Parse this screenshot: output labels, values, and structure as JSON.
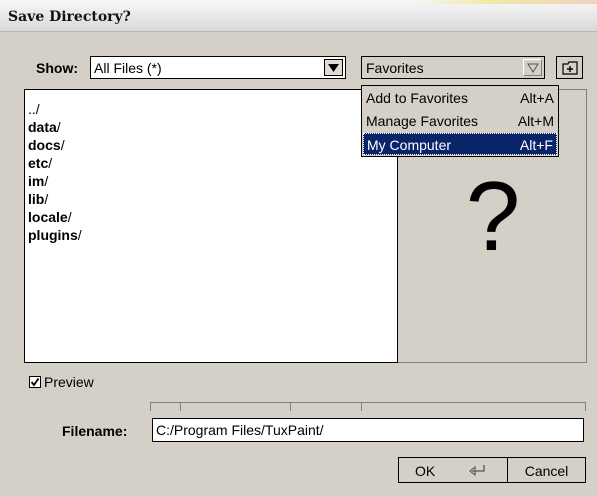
{
  "window": {
    "title": "Save Directory?"
  },
  "filter": {
    "label": "Show:",
    "value": "All Files (*)"
  },
  "favorites": {
    "value": "Favorites",
    "menu": [
      {
        "label": "Add to Favorites",
        "shortcut": "Alt+A",
        "selected": false
      },
      {
        "label": "Manage Favorites",
        "shortcut": "Alt+M",
        "selected": false
      },
      {
        "label": "My Computer",
        "shortcut": "Alt+F",
        "selected": true
      }
    ]
  },
  "files": [
    {
      "name": "..",
      "suffix": "/"
    },
    {
      "name": "data",
      "suffix": "/"
    },
    {
      "name": "docs",
      "suffix": "/"
    },
    {
      "name": "etc",
      "suffix": "/"
    },
    {
      "name": "im",
      "suffix": "/"
    },
    {
      "name": "lib",
      "suffix": "/"
    },
    {
      "name": "locale",
      "suffix": "/"
    },
    {
      "name": "plugins",
      "suffix": "/"
    }
  ],
  "preview": {
    "placeholder": "?",
    "checkbox_label": "Preview",
    "checked": true
  },
  "filename": {
    "label": "Filename:",
    "value": "C:/Program Files/TuxPaint/"
  },
  "buttons": {
    "ok": "OK",
    "cancel": "Cancel"
  },
  "icons": {
    "show_dropdown": "triangle-down-icon",
    "favorites_dropdown": "triangle-down-outline-icon",
    "new_directory": "new-folder-icon",
    "ok_return": "return-arrow-icon",
    "preview_check": "checkmark-icon"
  }
}
